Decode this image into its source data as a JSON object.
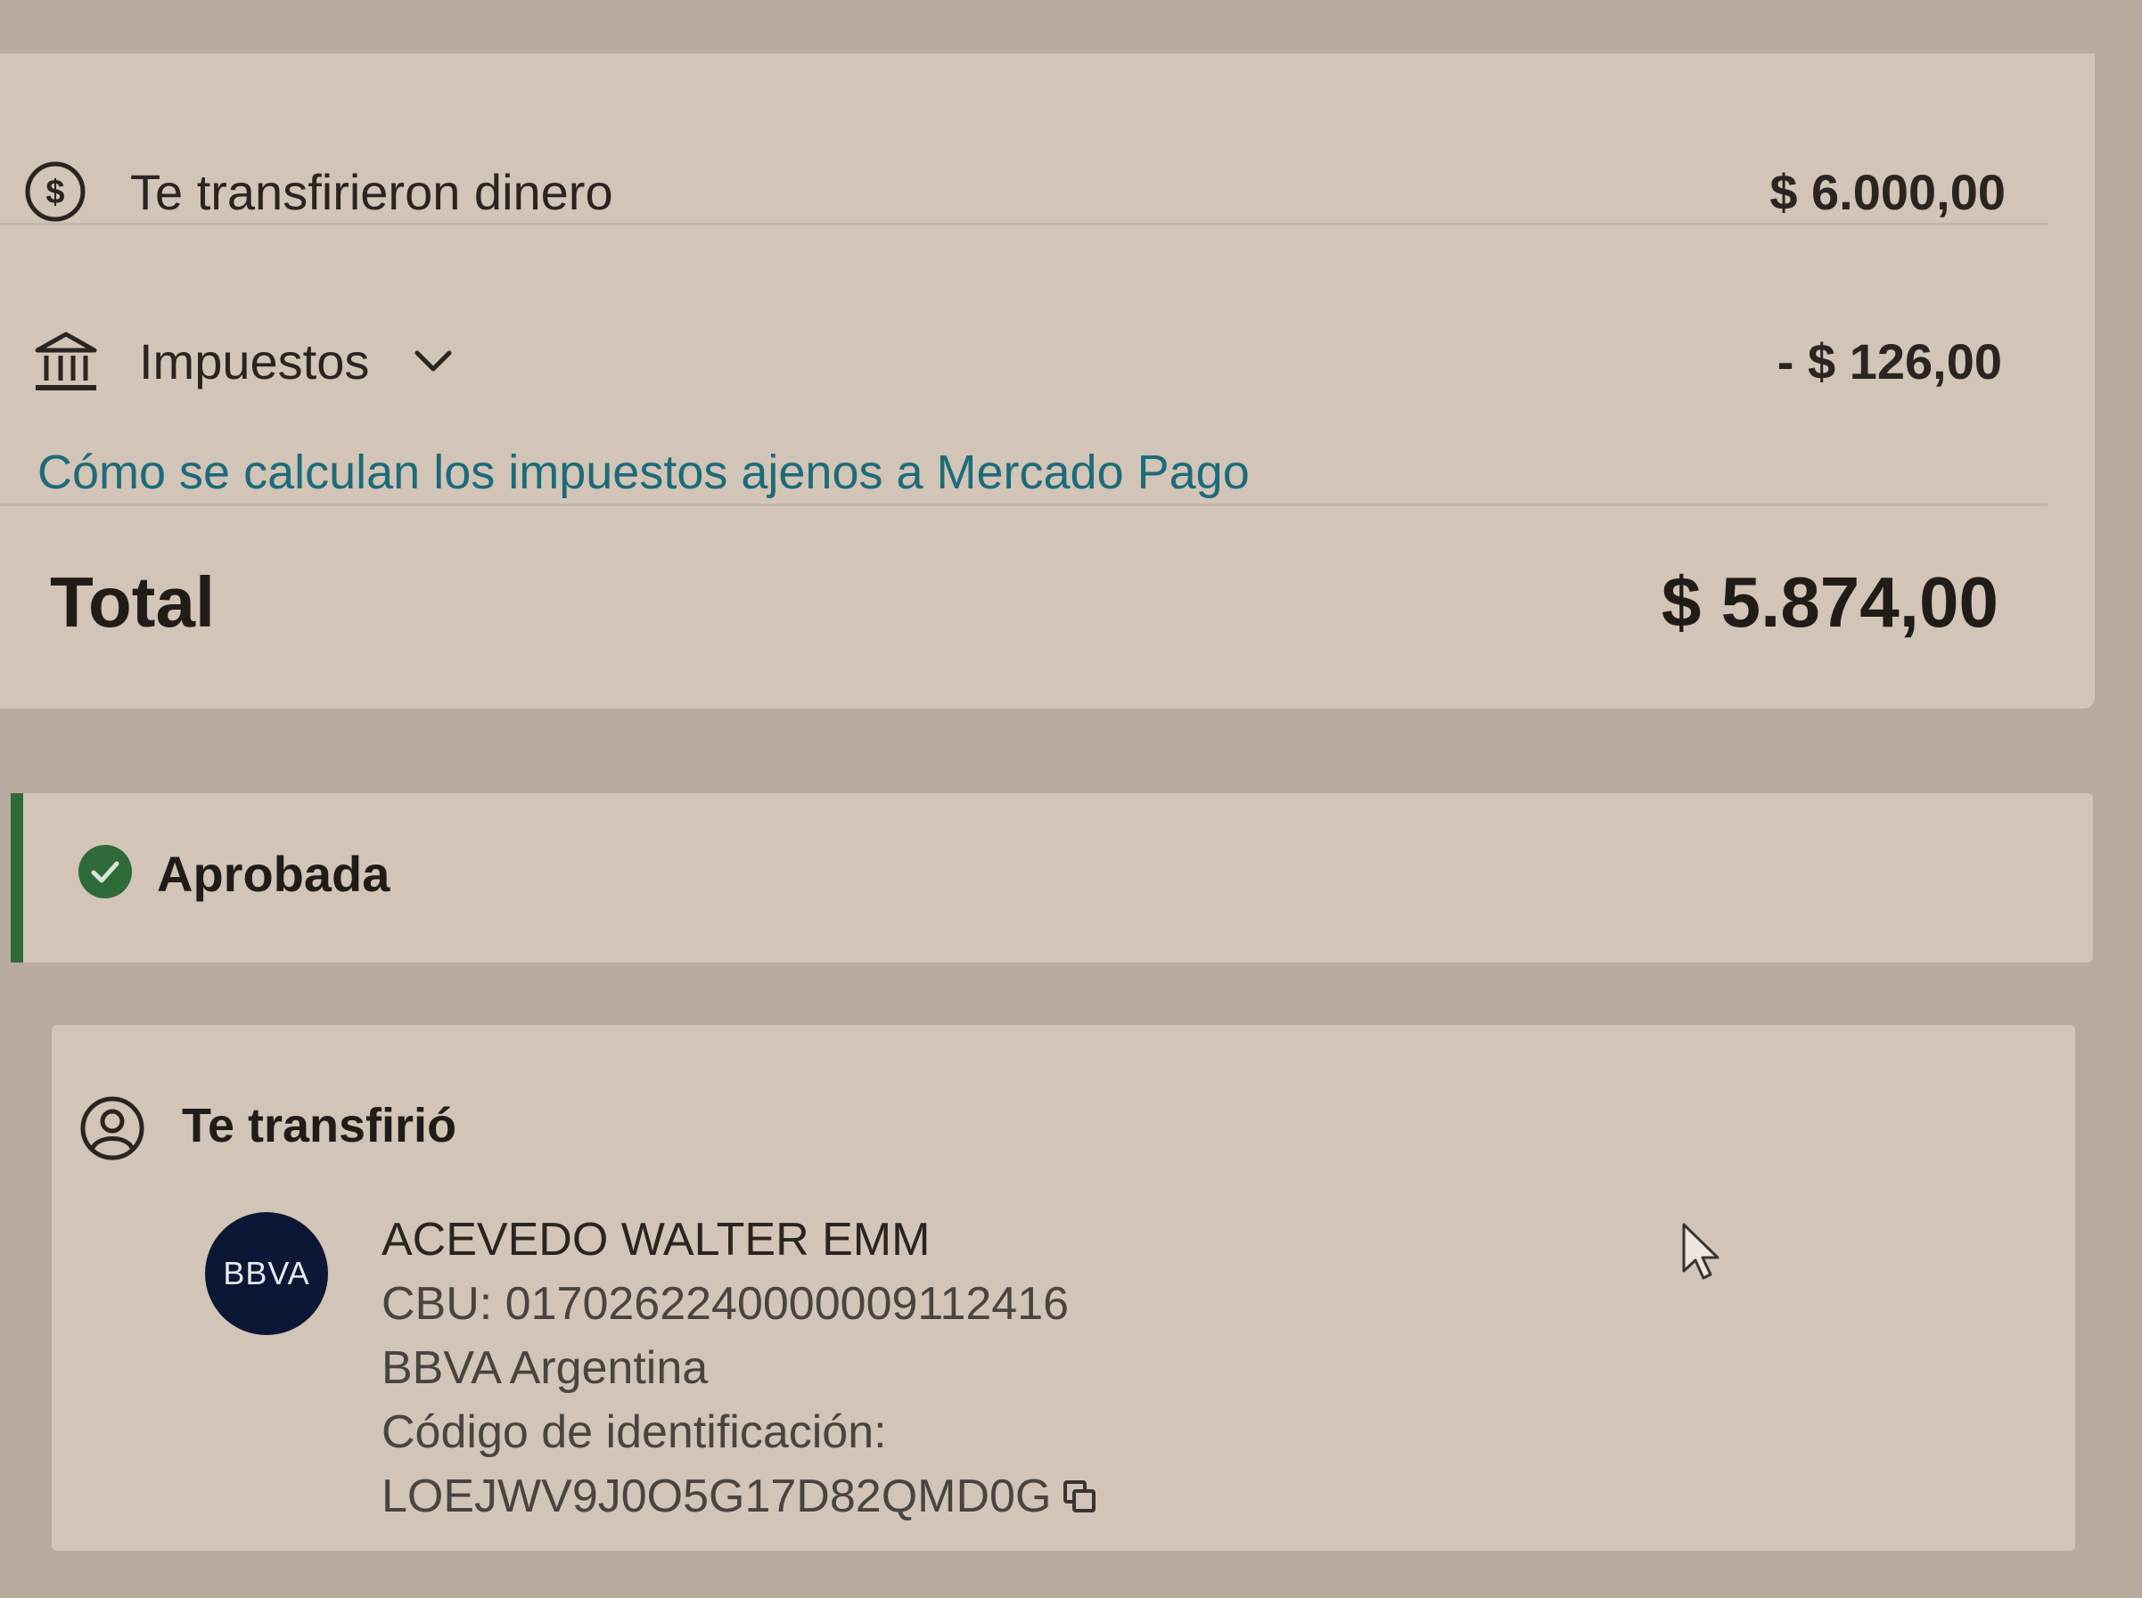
{
  "summary": {
    "credit": {
      "label": "Te transfirieron dinero",
      "amount": "$ 6.000,00",
      "icon": "dollar-circle-icon"
    },
    "taxes": {
      "label": "Impuestos",
      "amount": "- $ 126,00",
      "icon": "bank-building-icon"
    },
    "help_link": "Cómo se calculan los impuestos ajenos a Mercado Pago",
    "total": {
      "label": "Total",
      "amount": "$ 5.874,00"
    }
  },
  "status": {
    "label": "Aprobada",
    "color": "#2f6a3a",
    "icon": "check-circle-icon"
  },
  "sender": {
    "title": "Te transfirió",
    "icon": "person-circle-icon",
    "bank_logo_text": "BBVA",
    "name": "ACEVEDO WALTER EMM",
    "cbu": "CBU: 0170262240000009112416",
    "bank_name": "BBVA Argentina",
    "id_label": "Código de identificación:",
    "id_code": "LOEJWV9J0O5G17D82QMD0G",
    "copy_icon": "copy-icon"
  },
  "colors": {
    "link": "#1c6b7a",
    "approved": "#2f6a3a",
    "bank_logo_bg": "#0b1734"
  }
}
